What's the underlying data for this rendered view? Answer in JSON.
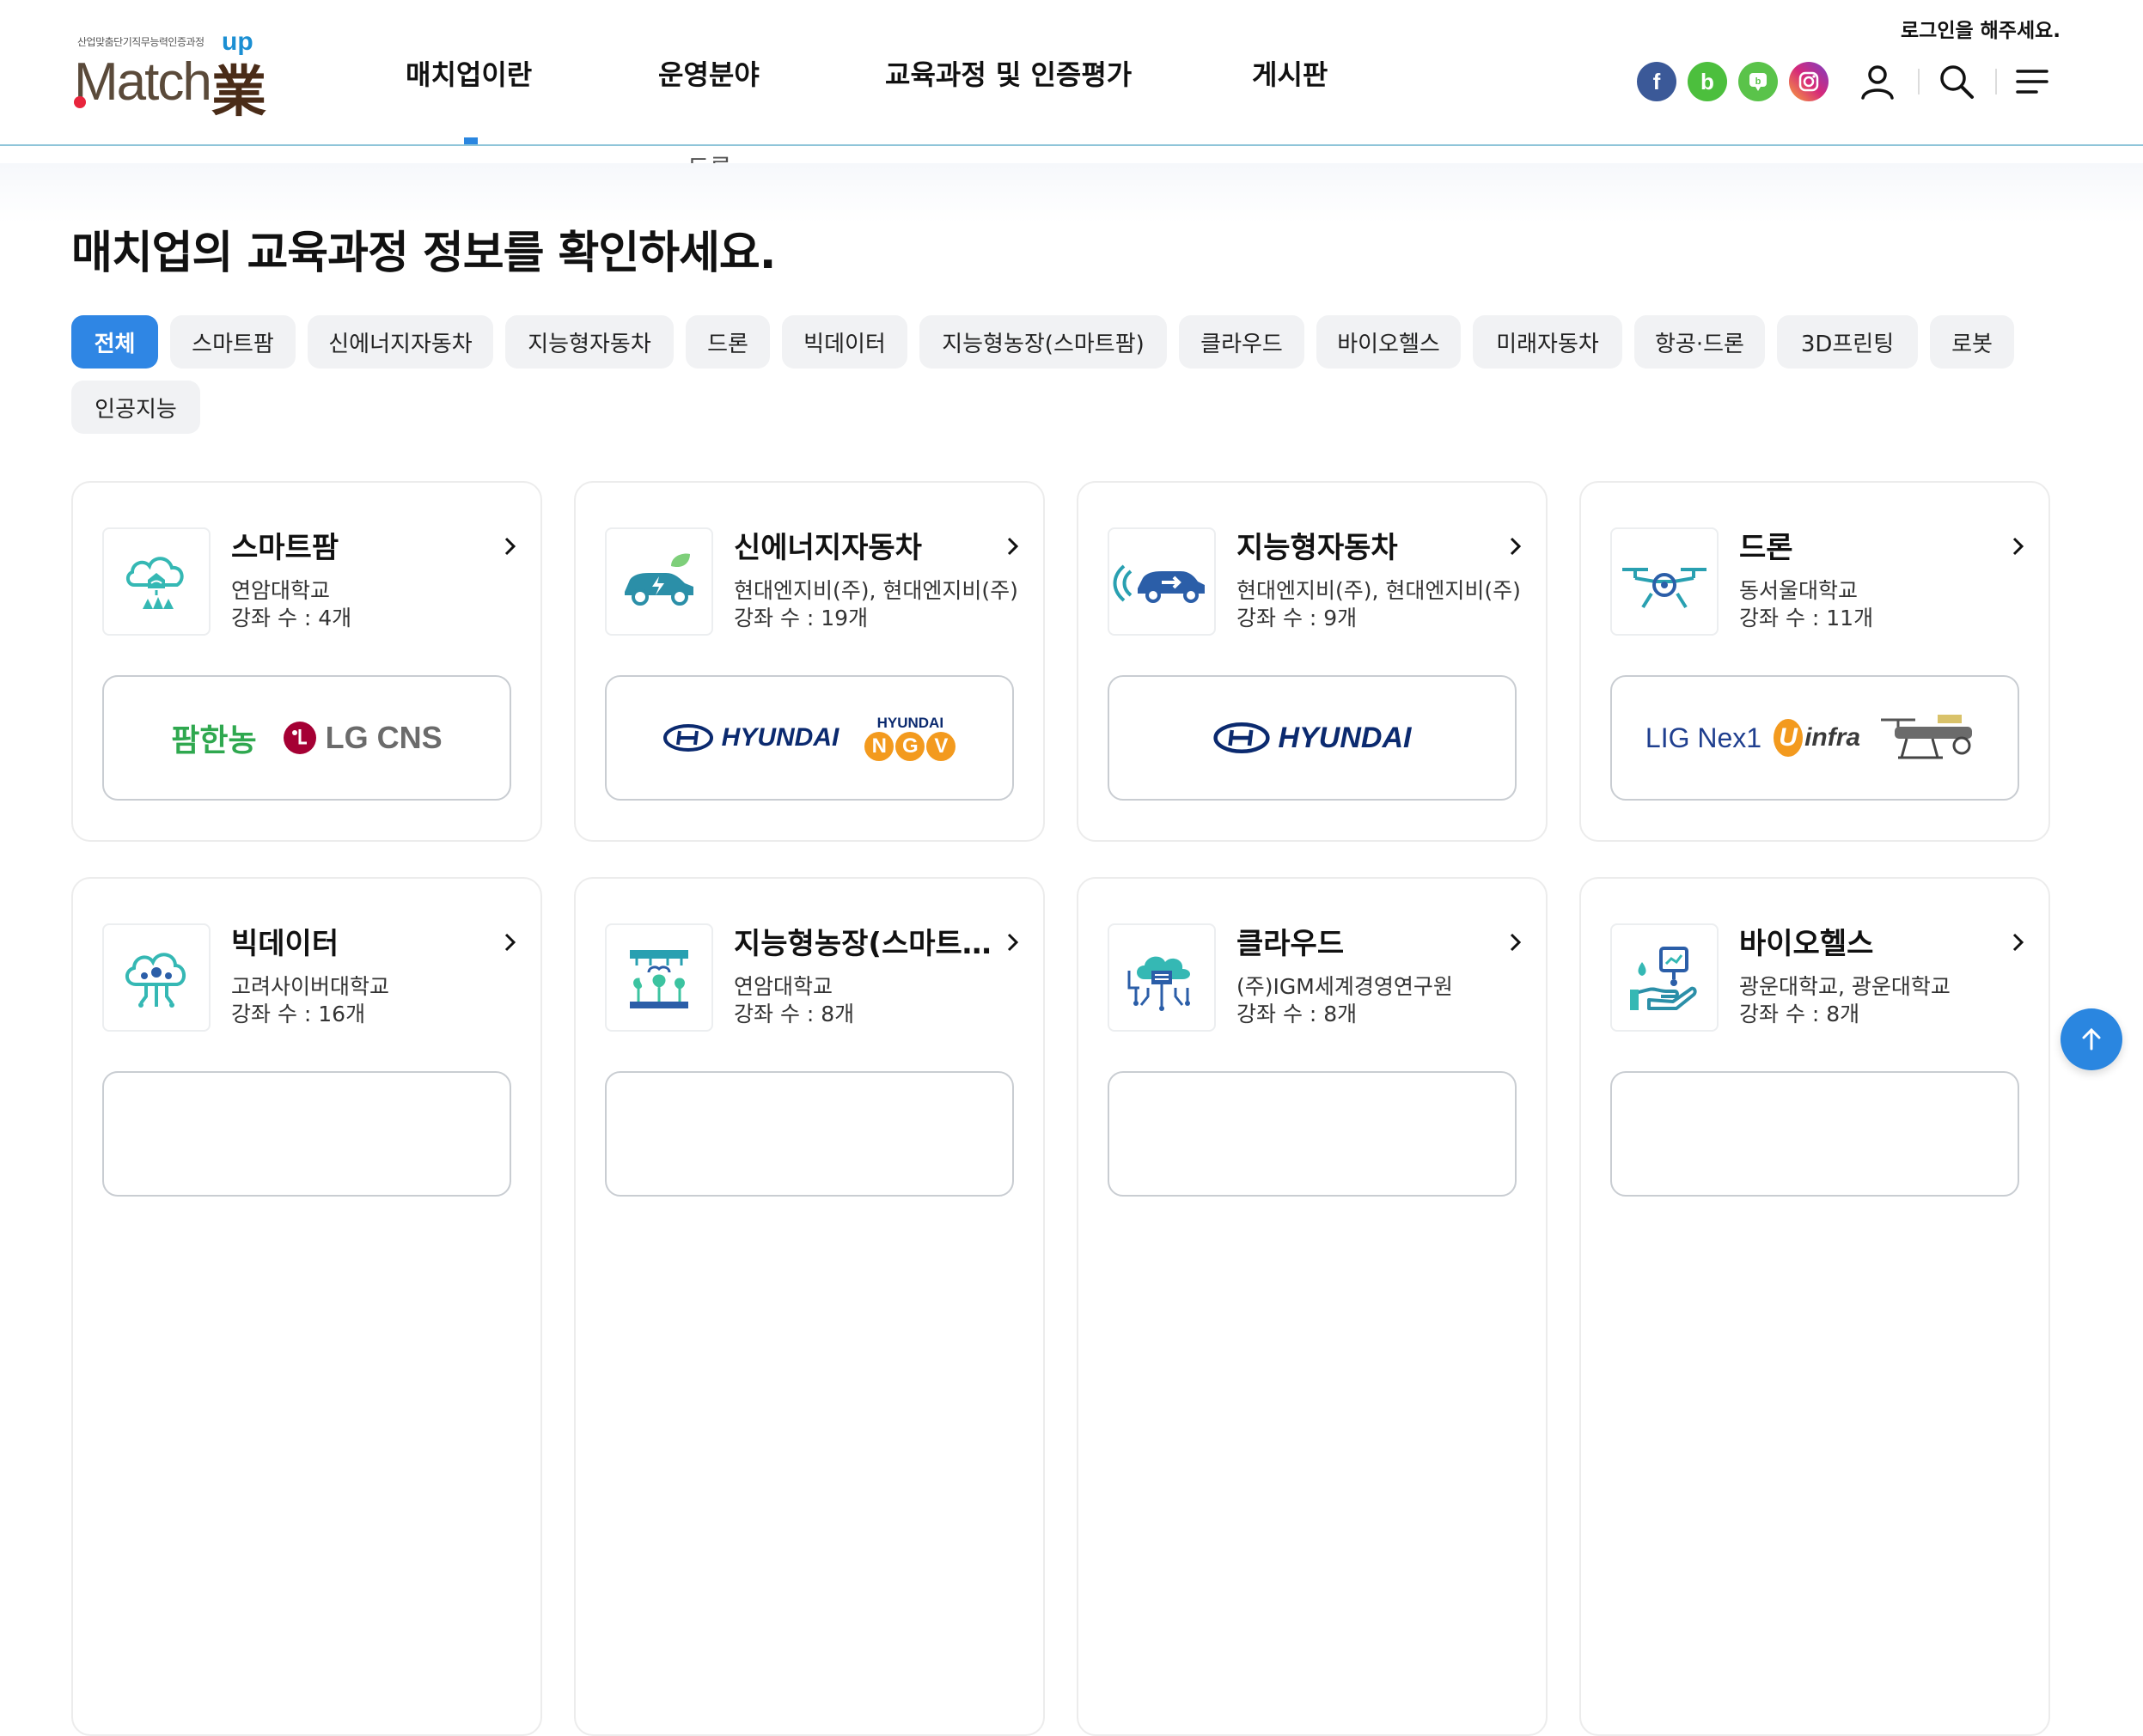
{
  "logo": {
    "small_text": "산업맞춤단기직무능력인증과정",
    "main": "Match",
    "up": "up",
    "han": "業"
  },
  "nav": [
    {
      "label": "매치업이란"
    },
    {
      "label": "운영분야"
    },
    {
      "label": "교육과정 및 인증평가"
    },
    {
      "label": "게시판"
    }
  ],
  "nav_ghost": "드론",
  "header": {
    "login_message": "로그인을 해주세요.",
    "sns": [
      {
        "name": "facebook",
        "glyph": "f",
        "color": "#3b5998"
      },
      {
        "name": "band",
        "glyph": "b",
        "color": "#4cbf3d"
      },
      {
        "name": "blog",
        "glyph": "b",
        "color": "#5ac34a"
      },
      {
        "name": "instagram",
        "glyph": "◎",
        "color": "#c13584"
      }
    ]
  },
  "page_title": "매치업의 교육과정 정보를 확인하세요.",
  "filters": [
    "전체",
    "스마트팜",
    "신에너지자동차",
    "지능형자동차",
    "드론",
    "빅데이터",
    "지능형농장(스마트팜)",
    "클라우드",
    "바이오헬스",
    "미래자동차",
    "항공·드론",
    "3D프린팅",
    "로봇",
    "인공지능"
  ],
  "count_prefix": "강좌 수 : ",
  "cards": [
    {
      "title": "스마트팜",
      "org": "연암대학교",
      "count": "4개",
      "icon": "smart-farm-icon",
      "logos": [
        "팜한농",
        "LG CNS"
      ]
    },
    {
      "title": "신에너지자동차",
      "org": "현대엔지비(주), 현대엔지비(주)",
      "count": "19개",
      "icon": "electric-car-icon",
      "logos": [
        "HYUNDAI",
        "HYUNDAI NGV"
      ]
    },
    {
      "title": "지능형자동차",
      "org": "현대엔지비(주), 현대엔지비(주)",
      "count": "9개",
      "icon": "smart-car-icon",
      "logos": [
        "HYUNDAI"
      ]
    },
    {
      "title": "드론",
      "org": "동서울대학교",
      "count": "11개",
      "icon": "drone-icon",
      "logos": [
        "LIG Nex1",
        "infra"
      ]
    },
    {
      "title": "빅데이터",
      "org": "고려사이버대학교",
      "count": "16개",
      "icon": "big-data-icon",
      "logos": []
    },
    {
      "title": "지능형농장(스마트팜)",
      "org": "연암대학교",
      "count": "8개",
      "icon": "smart-greenhouse-icon",
      "logos": []
    },
    {
      "title": "클라우드",
      "org": "(주)IGM세계경영연구원",
      "count": "8개",
      "icon": "cloud-icon",
      "logos": []
    },
    {
      "title": "바이오헬스",
      "org": "광운대학교, 광운대학교",
      "count": "8개",
      "icon": "bio-health-icon",
      "logos": []
    }
  ],
  "brand_colors": {
    "hyundai": "#0b2a6f",
    "lg": "#a50034",
    "accent": "#2f86e4",
    "ngv": "#f39a1e",
    "lig": "#1f3f8f"
  }
}
